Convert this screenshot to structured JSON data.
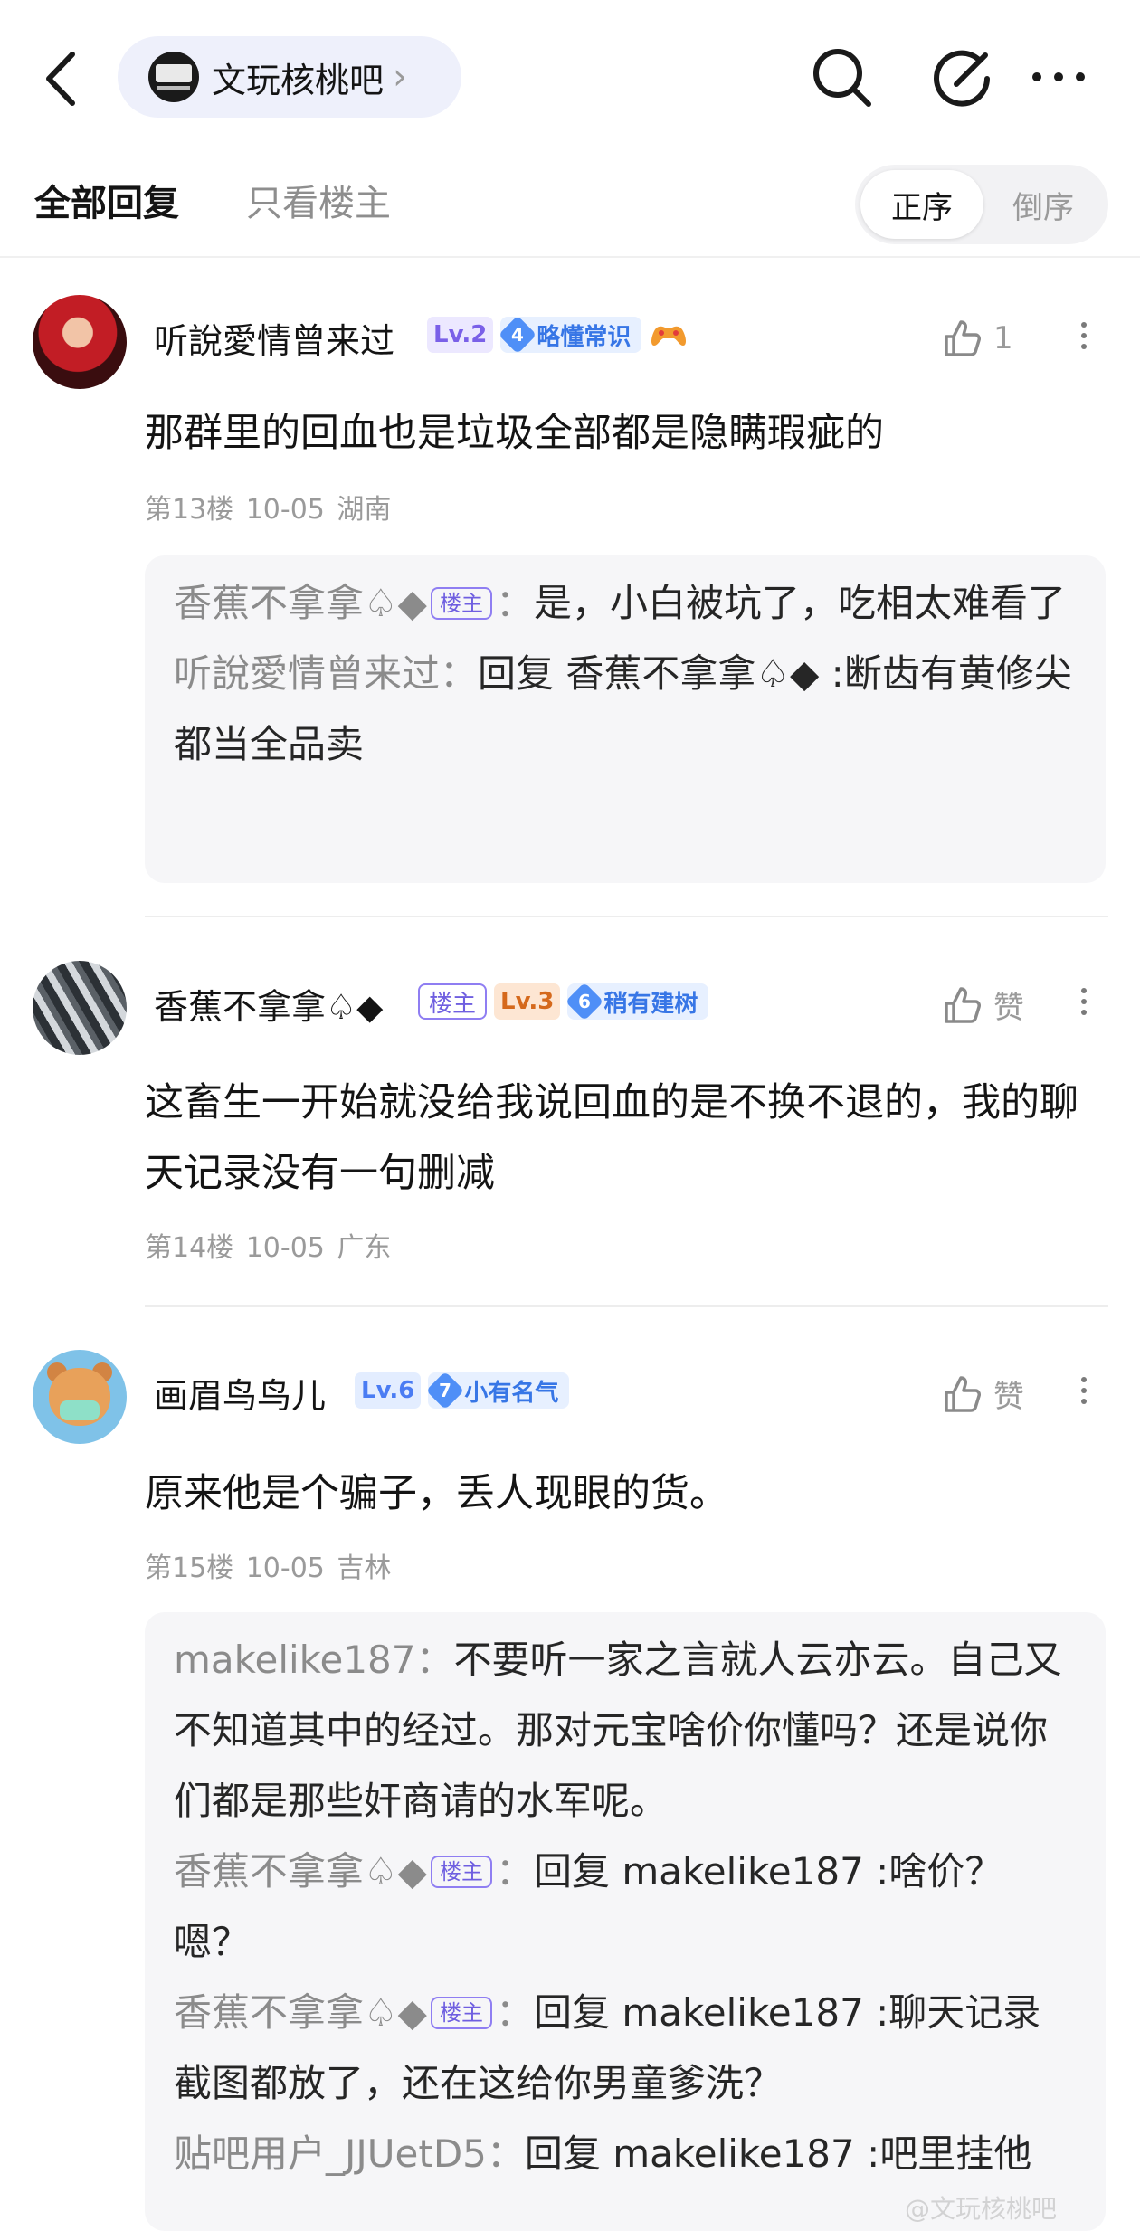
{
  "header": {
    "forum_name": "文玩核桃吧",
    "forum_chevron": "›"
  },
  "tabs": {
    "all": "全部回复",
    "owner_only": "只看楼主",
    "order_asc": "正序",
    "order_desc": "倒序"
  },
  "comments": [
    {
      "username": "听說愛情曾来过",
      "level": "Lv.2",
      "title_num": "4",
      "title": "略懂常识",
      "like_count": "1",
      "text": "那群里的回血也是垃圾全部都是隐瞒瑕疵的",
      "meta": "第13楼  10-05  湖南",
      "replies": [
        {
          "name": "香蕉不拿拿♤◆",
          "owner_tag": "楼主",
          "sep": "：",
          "text": "是，小白被坑了，吃相太难看了"
        },
        {
          "name": "听說愛情曾来过",
          "sep": "：",
          "text": "回复 香蕉不拿拿♤◆ :断齿有黄修尖都当全品卖"
        }
      ]
    },
    {
      "username": "香蕉不拿拿♤◆",
      "owner_tag": "楼主",
      "level": "Lv.3",
      "title_num": "6",
      "title": "稍有建树",
      "like_label": "赞",
      "text": "这畜生一开始就没给我说回血的是不换不退的，我的聊天记录没有一句删减",
      "meta": "第14楼  10-05  广东"
    },
    {
      "username": "画眉鸟鸟儿",
      "level": "Lv.6",
      "title_num": "7",
      "title": "小有名气",
      "like_label": "赞",
      "text": "原来他是个骗子，丢人现眼的货。",
      "meta": "第15楼  10-05  吉林",
      "replies": [
        {
          "name": "makelike187",
          "sep": "：",
          "text": "不要听一家之言就人云亦云。自己又不知道其中的经过。那对元宝啥价你懂吗？还是说你们都是那些奸商请的水军呢。"
        },
        {
          "name": "香蕉不拿拿♤◆",
          "owner_tag": "楼主",
          "sep": "：",
          "text": "回复 makelike187 :啥价？嗯？"
        },
        {
          "name": "香蕉不拿拿♤◆",
          "owner_tag": "楼主",
          "sep": "：",
          "text": "回复 makelike187 :聊天记录截图都放了，还在这给你男童爹洗？"
        },
        {
          "name": "贴吧用户_JJUetD5",
          "sep": "：",
          "text": "回复 makelike187 :吧里挂他"
        }
      ]
    }
  ],
  "watermark": "@文玩核桃吧",
  "colors": {
    "accent_purple": "#7a60e8",
    "title_blue": "#3776e6",
    "muted_gray": "#9a9a9a"
  },
  "icons": [
    "back-arrow-icon",
    "search-icon",
    "compose-icon",
    "more-icon",
    "thumbs-up-icon",
    "kebab-icon",
    "diamond-badge-icon",
    "game-controller-icon"
  ]
}
